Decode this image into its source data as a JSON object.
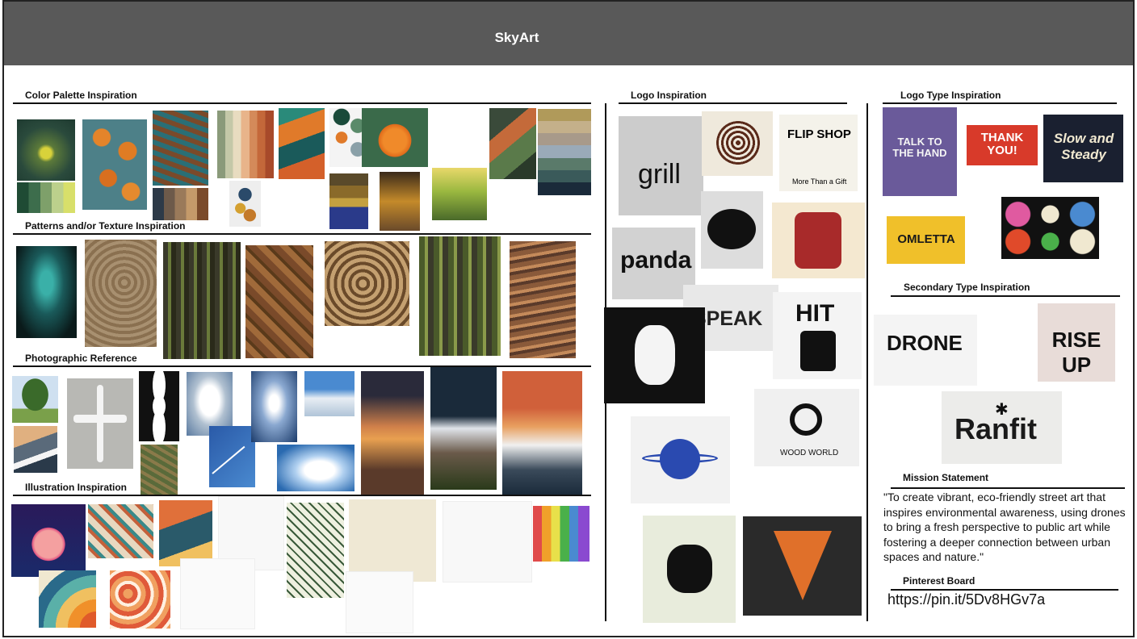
{
  "header": {
    "title": "SkyArt"
  },
  "sections": {
    "color_palette": "Color Palette Inspiration",
    "patterns": "Patterns and/or Texture Inspiration",
    "photographic": "Photographic Reference",
    "illustration": "Illustration Inspiration",
    "logo": "Logo Inspiration",
    "logo_type": "Logo Type Inspiration",
    "secondary_type": "Secondary Type Inspiration",
    "mission": "Mission Statement",
    "pinterest": "Pinterest Board"
  },
  "logos": {
    "grill": "grill",
    "flip_shop": "FLIP SHOP",
    "flip_shop_sub": "More Than a Gift",
    "panda": "panda",
    "speak": "SPEAK",
    "hit": "HIT",
    "wood_world": "WOOD WORLD"
  },
  "type_samples": {
    "talk": "TALK TO THE HAND",
    "thank": "THANK YOU!",
    "slow": "Slow and Steady",
    "omletta": "OMLETTA",
    "drone": "DRONE",
    "rise_up": "RISE UP",
    "ranfit": "Ranfit"
  },
  "mission_text": "\"To create vibrant, eco-friendly street art that inspires environmental awareness, using drones to bring a fresh perspective to public art while fostering a deeper connection between urban spaces and nature.\"",
  "pinterest_url": "https://pin.it/5Dv8HGv7a"
}
